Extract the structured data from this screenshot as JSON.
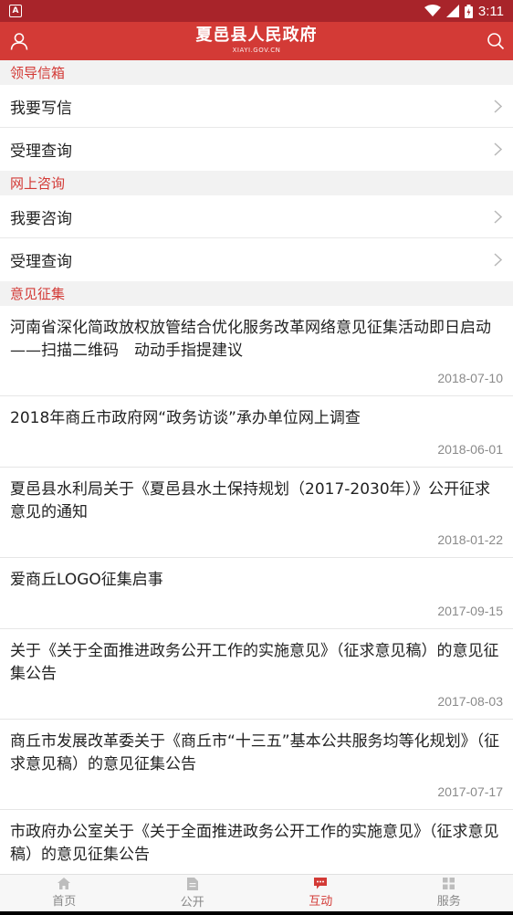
{
  "status_bar": {
    "notification_icon": "A",
    "time": "3:11",
    "icons": [
      "wifi-icon",
      "signal-icon",
      "battery-icon"
    ]
  },
  "app_bar": {
    "title": "夏邑县人民政府",
    "subtitle": "XIAYI.GOV.CN",
    "left_icon": "user-icon",
    "right_icon": "search-icon",
    "color": "#d33a36"
  },
  "sections": {
    "leader_mailbox": {
      "header": "领导信箱",
      "items": [
        {
          "label": "我要写信"
        },
        {
          "label": "受理查询"
        }
      ]
    },
    "online_consult": {
      "header": "网上咨询",
      "items": [
        {
          "label": "我要咨询"
        },
        {
          "label": "受理查询"
        }
      ]
    },
    "opinion": {
      "header": "意见征集",
      "items": [
        {
          "title": "河南省深化简政放权放管结合优化服务改革网络意见征集活动即日启动——扫描二维码　动动手指提建议",
          "date": "2018-07-10"
        },
        {
          "title": "2018年商丘市政府网“政务访谈”承办单位网上调查",
          "date": "2018-06-01"
        },
        {
          "title": "夏邑县水利局关于《夏邑县水土保持规划（2017-2030年）》公开征求意见的通知",
          "date": "2018-01-22"
        },
        {
          "title": "爱商丘LOGO征集启事",
          "date": "2017-09-15"
        },
        {
          "title": "关于《关于全面推进政务公开工作的实施意见》（征求意见稿）的意见征集公告",
          "date": "2017-08-03"
        },
        {
          "title": "商丘市发展改革委关于《商丘市“十三五”基本公共服务均等化规划》（征求意见稿）的意见征集公告",
          "date": "2017-07-17"
        },
        {
          "title": "市政府办公室关于《关于全面推进政务公开工作的实施意见》（征求意见稿）的意见征集公告",
          "date": ""
        }
      ]
    }
  },
  "tabs": [
    {
      "label": "首页",
      "icon": "home-icon",
      "active": false
    },
    {
      "label": "公开",
      "icon": "document-icon",
      "active": false
    },
    {
      "label": "互动",
      "icon": "chat-icon",
      "active": true
    },
    {
      "label": "服务",
      "icon": "grid-icon",
      "active": false
    }
  ]
}
